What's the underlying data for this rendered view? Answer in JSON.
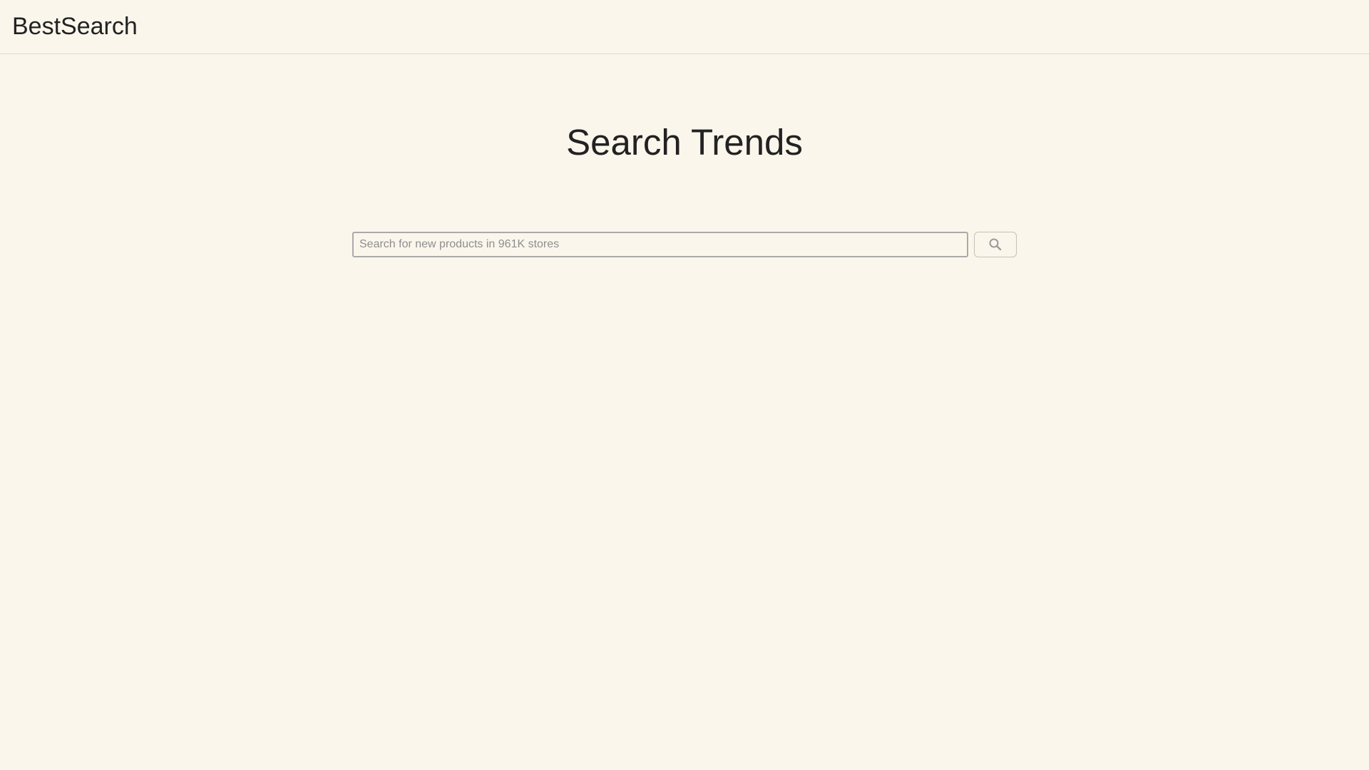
{
  "header": {
    "brand": "BestSearch"
  },
  "main": {
    "title": "Search Trends",
    "search": {
      "placeholder": "Search for new products in 961K stores",
      "value": "",
      "button_icon": "search-icon"
    }
  },
  "colors": {
    "background": "#faf6ec",
    "text": "#222222",
    "divider": "#dedad2",
    "input_border": "#aaaaaa",
    "placeholder": "#8e8e8e",
    "icon": "#9a9a9a"
  }
}
